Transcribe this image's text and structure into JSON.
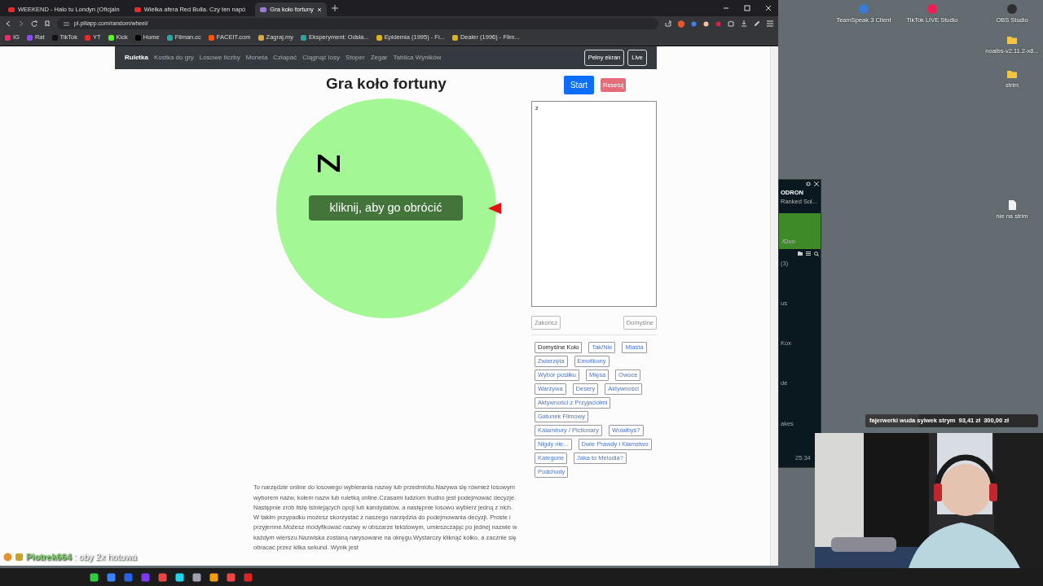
{
  "browser": {
    "tabs": [
      {
        "title": "WEEKEND - Halo tu Londyn (Oficjaln",
        "selected": false,
        "color": "#e52d27"
      },
      {
        "title": "Wielka afera Red Bulla. Czy ten napó",
        "selected": false,
        "color": "#e52d27"
      },
      {
        "title": "Gra koło fortuny",
        "selected": true,
        "color": "#9b7fd4"
      }
    ],
    "url": "pl.piliapp.com/random/wheel/",
    "bookmarks": [
      {
        "label": "IG",
        "color": "#e1306c"
      },
      {
        "label": "Rat",
        "color": "#9146ff"
      },
      {
        "label": "TikTok",
        "color": "#111111"
      },
      {
        "label": "YT",
        "color": "#e52d27"
      },
      {
        "label": "Kick",
        "color": "#53fc18"
      },
      {
        "label": "Home",
        "color": "#000000"
      },
      {
        "label": "Filman.cc",
        "color": "#2aa6a0"
      },
      {
        "label": "FACEIT.com",
        "color": "#ff5500"
      },
      {
        "label": "Zagraj.my",
        "color": "#d9a93b"
      },
      {
        "label": "Eksperyment: Odsła...",
        "color": "#2aa6a0"
      },
      {
        "label": "Epidemia (1995) - Fi...",
        "color": "#d9b418"
      },
      {
        "label": "Dealer (1996) - Film...",
        "color": "#d9b418"
      }
    ]
  },
  "page": {
    "nav": {
      "items": [
        {
          "label": "Ruletka",
          "selected": true
        },
        {
          "label": "Kostka do gry",
          "selected": false
        },
        {
          "label": "Losowe liczby",
          "selected": false
        },
        {
          "label": "Moneta",
          "selected": false
        },
        {
          "label": "Człapać",
          "selected": false
        },
        {
          "label": "Ciągnąć losy",
          "selected": false
        },
        {
          "label": "Stoper",
          "selected": false
        },
        {
          "label": "Zegar",
          "selected": false
        },
        {
          "label": "Tablica Wyników",
          "selected": false
        }
      ],
      "buttons": [
        "Pełny ekran",
        "Live"
      ]
    },
    "title": "Gra koło fortuny",
    "start": "Start",
    "reset": "Resetuj",
    "wheel": {
      "segments": [
        {
          "label": "z",
          "color": "#a3f794"
        }
      ],
      "overlay": "kliknij, aby go obrócić"
    },
    "entries": "z",
    "finish": "Zakończ",
    "defaults": "Domyślne",
    "presets": [
      {
        "label": "Domyślne Koło",
        "selected": true
      },
      {
        "label": "Tak/Nie",
        "selected": false
      },
      {
        "label": "Miasta",
        "selected": false
      },
      {
        "label": "Zwierzęta",
        "selected": false
      },
      {
        "label": "Emotikony",
        "selected": false
      },
      {
        "label": "Wybór posiłku",
        "selected": false
      },
      {
        "label": "Mięsa",
        "selected": false
      },
      {
        "label": "Owoce",
        "selected": false
      },
      {
        "label": "Warzywa",
        "selected": false
      },
      {
        "label": "Desery",
        "selected": false
      },
      {
        "label": "Aktywności",
        "selected": false
      },
      {
        "label": "Aktywności z Przyjaciółmi",
        "selected": false
      },
      {
        "label": "Gatunek Filmowy",
        "selected": false
      },
      {
        "label": "Kalambury / Pictionary",
        "selected": false
      },
      {
        "label": "Wolałbyś?",
        "selected": false
      },
      {
        "label": "Nigdy nie...",
        "selected": false
      },
      {
        "label": "Dwie Prawdy i Kłamstwo",
        "selected": false
      },
      {
        "label": "Kategorie",
        "selected": false
      },
      {
        "label": "Jaka to Melodia?",
        "selected": false
      },
      {
        "label": "Podchody",
        "selected": false
      }
    ],
    "description": "To narzędzie online do losowego wybierania nazwy lub przedmiotu.Nazywa się również losowym wyborem nazw, kołem nazw lub ruletką online.Czasami ludziom trudno jest podejmować decyzje. Następnie zrób listę istniejących opcji lub kandydatów, a następnie losowo wybierz jedną z nich. W takim przypadku możesz skorzystać z naszego narzędzia do podejmowania decyzji. Proste i przyjemne.Możesz modyfikować nazwy w obszarze tekstowym, umieszczając po jednej nazwie w każdym wierszu.Nazwiska zostaną narysowane na okręgu.Wystarczy kliknąć kółko, a zacznie się obracać przez kilka sekund. Wynik jest"
  },
  "desktop": {
    "icons": [
      {
        "label": "TeamSpeak 3 Client",
        "kind": "app",
        "color": "#3a7bd5"
      },
      {
        "label": "TikTok LIVE Studio",
        "kind": "app",
        "color": "#ee1d52"
      },
      {
        "label": "OBS Studio",
        "kind": "app",
        "color": "#302e31"
      },
      {
        "label": "noalbs-v2.11.2-x8...",
        "kind": "folder",
        "color": "#f5c542"
      },
      {
        "label": "strim",
        "kind": "folder",
        "color": "#f5c542"
      },
      {
        "label": "nie na strim",
        "kind": "file",
        "color": "#f2f2f2"
      }
    ],
    "side_app": {
      "title": "ODRON",
      "subtitle": "Ranked Sol...",
      "banner": "/Duo",
      "rows": [
        "(3)",
        "us",
        "Kox",
        "de",
        "akes"
      ],
      "footer": "25.34"
    },
    "donation": {
      "title": "fajerwerki wuda sylwek strym",
      "raised": "93,41 zł",
      "goal": "300,00 zł",
      "level": 0.31
    },
    "chat": {
      "user": "Piotrek664",
      "message": ": oby 2x hotuwa"
    }
  }
}
